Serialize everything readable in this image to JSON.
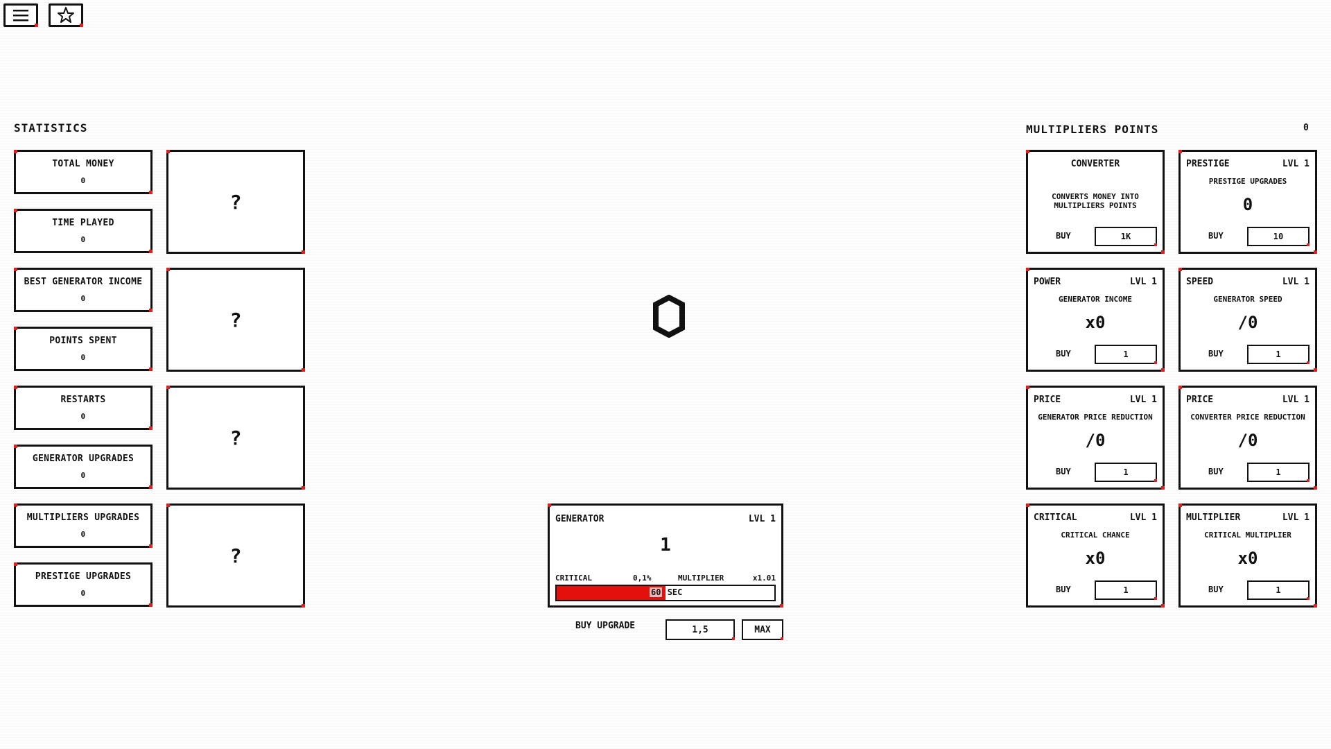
{
  "topbar": {
    "menu_icon": "hamburger-menu-icon",
    "fav_icon": "star-icon"
  },
  "statistics": {
    "title": "STATISTICS",
    "items": [
      {
        "label": "TOTAL MONEY",
        "value": "0"
      },
      {
        "label": "TIME PLAYED",
        "value": "0"
      },
      {
        "label": "BEST GENERATOR INCOME",
        "value": "0"
      },
      {
        "label": "POINTS SPENT",
        "value": "0"
      },
      {
        "label": "RESTARTS",
        "value": "0"
      },
      {
        "label": "GENERATOR UPGRADES",
        "value": "0"
      },
      {
        "label": "MULTIPLIERS UPGRADES",
        "value": "0"
      },
      {
        "label": "PRESTIGE UPGRADES",
        "value": "0"
      }
    ],
    "locked": [
      "?",
      "?",
      "?",
      "?"
    ]
  },
  "center": {
    "money_icon": "coin-icon",
    "generator": {
      "title": "GENERATOR",
      "level": "LVL 1",
      "value": "1",
      "critical_label": "CRITICAL",
      "critical_value": "0,1%",
      "multiplier_label": "MULTIPLIER",
      "multiplier_value": "x1.01",
      "timer_value": "60",
      "timer_unit": "SEC",
      "progress_fraction": 0.5
    },
    "buy_upgrade_label": "BUY UPGRADE",
    "buy_upgrade_price": "1,5",
    "max_label": "MAX"
  },
  "multipliers": {
    "title": "MULTIPLIERS POINTS",
    "points": "0",
    "cards": [
      {
        "title": "CONVERTER",
        "level": "",
        "subtitle": "CONVERTS MONEY INTO MULTIPLIERS POINTS",
        "value": "",
        "buy": "BUY",
        "price": "1K"
      },
      {
        "title": "PRESTIGE",
        "level": "LVL 1",
        "subtitle": "PRESTIGE UPGRADES",
        "value": "0",
        "buy": "BUY",
        "price": "10"
      },
      {
        "title": "POWER",
        "level": "LVL 1",
        "subtitle": "GENERATOR INCOME",
        "value": "x0",
        "buy": "BUY",
        "price": "1"
      },
      {
        "title": "SPEED",
        "level": "LVL 1",
        "subtitle": "GENERATOR SPEED",
        "value": "/0",
        "buy": "BUY",
        "price": "1"
      },
      {
        "title": "PRICE",
        "level": "LVL 1",
        "subtitle": "GENERATOR PRICE REDUCTION",
        "value": "/0",
        "buy": "BUY",
        "price": "1"
      },
      {
        "title": "PRICE",
        "level": "LVL 1",
        "subtitle": "CONVERTER PRICE REDUCTION",
        "value": "/0",
        "buy": "BUY",
        "price": "1"
      },
      {
        "title": "CRITICAL",
        "level": "LVL 1",
        "subtitle": "CRITICAL CHANCE",
        "value": "x0",
        "buy": "BUY",
        "price": "1"
      },
      {
        "title": "MULTIPLIER",
        "level": "LVL 1",
        "subtitle": "CRITICAL MULTIPLIER",
        "value": "x0",
        "buy": "BUY",
        "price": "1"
      }
    ]
  },
  "colors": {
    "accent": "#e3100e",
    "ink": "#111111",
    "background": "#fdfdfd"
  }
}
